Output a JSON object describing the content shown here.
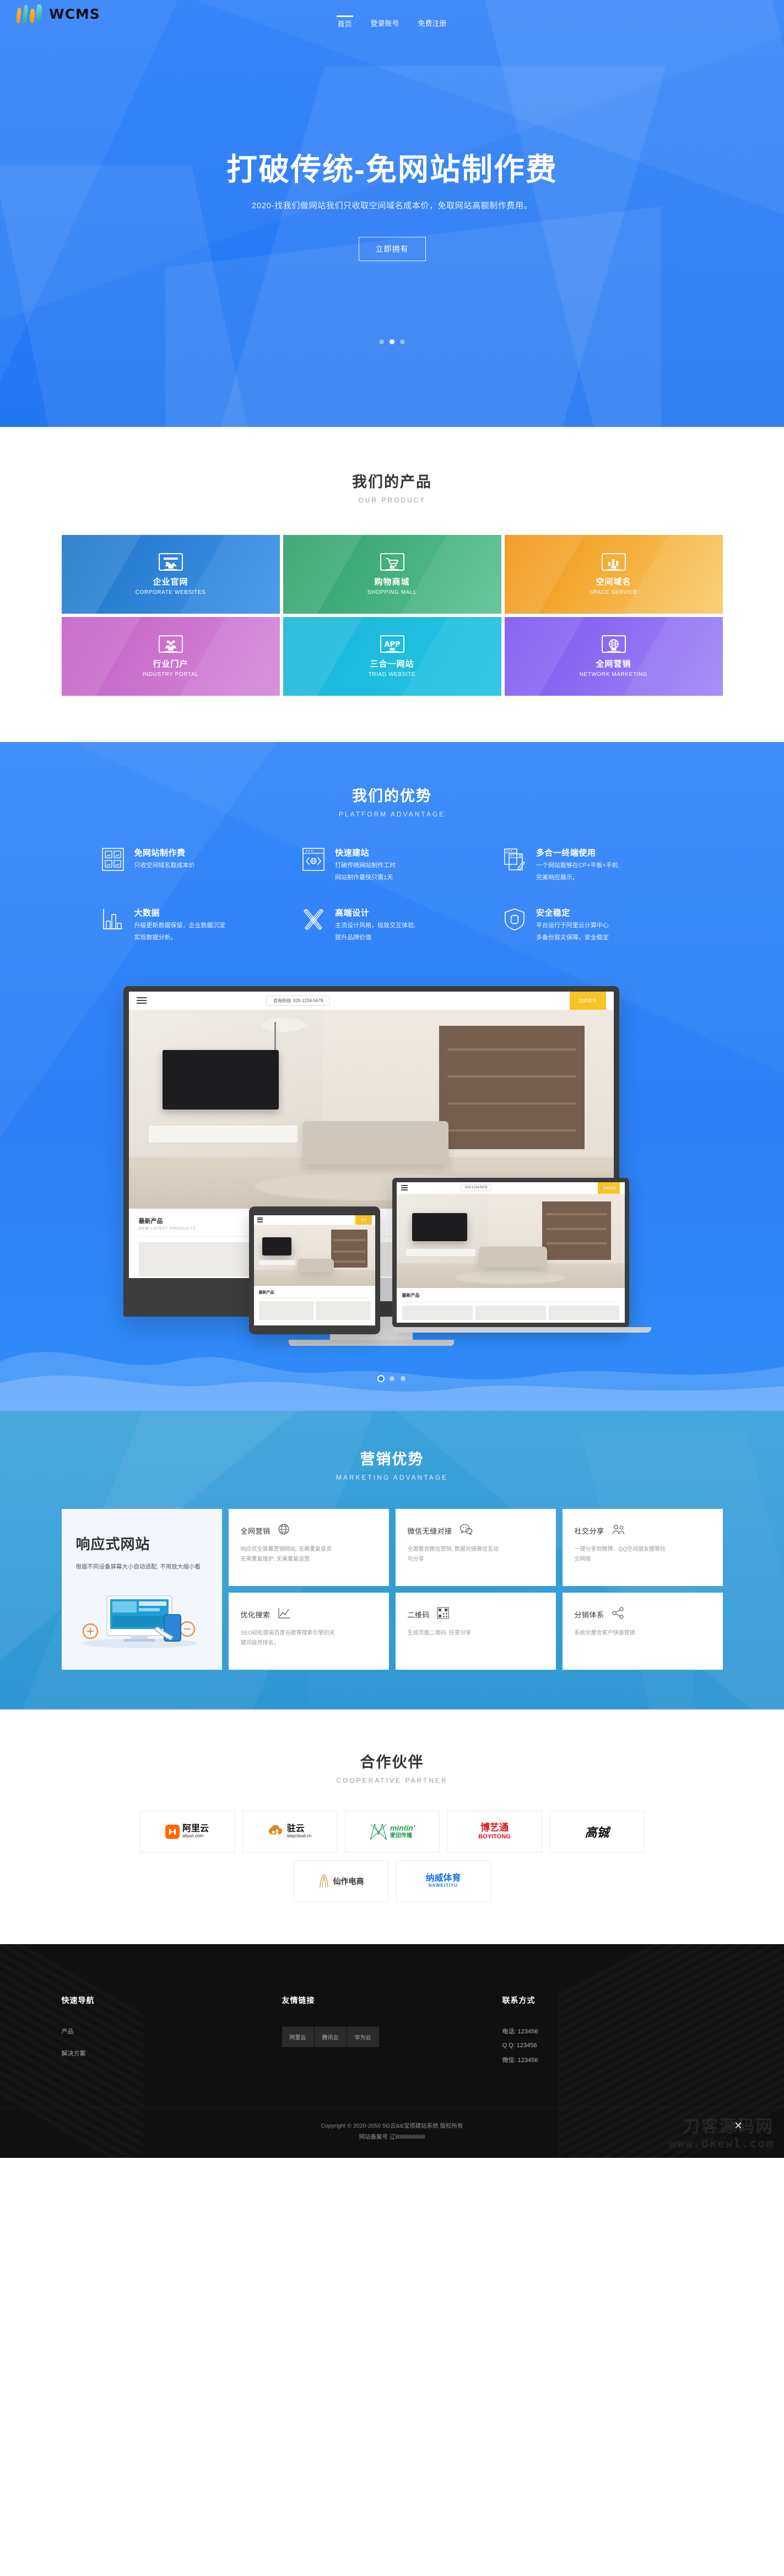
{
  "brand": {
    "name": "WCMS",
    "logo_icon": "wcms-logo-icon"
  },
  "nav": {
    "items": [
      {
        "label": "首页",
        "active": true
      },
      {
        "label": "登录账号",
        "active": false
      },
      {
        "label": "免费注册",
        "active": false
      }
    ]
  },
  "hero": {
    "title": "打破传统-免网站制作费",
    "subtitle": "2020-找我们做网站我们只收取空间域名成本价，免取网站高额制作费用。",
    "button": "立即拥有",
    "slides": 3,
    "active_slide": 2
  },
  "products": {
    "heading_cn": "我们的产品",
    "heading_en": "OUR PRODUCT",
    "cards": [
      {
        "cn": "企业官网",
        "en": "CORPORATE WEBSITES",
        "icon": "monitor-image-icon",
        "color_from": "#1f76c8",
        "color_to": "#3f93ea"
      },
      {
        "cn": "购物商城",
        "en": "SHOPPING MALL",
        "icon": "monitor-cart-icon",
        "color_from": "#2d9f68",
        "color_to": "#5ec296"
      },
      {
        "cn": "空间域名",
        "en": "SPACE SERVICE",
        "icon": "monitor-chart-icon",
        "color_from": "#ef9311",
        "color_to": "#f8cc6a"
      },
      {
        "cn": "行业门户",
        "en": "INDUSTRY PORTAL",
        "icon": "monitor-users-icon",
        "color_from": "#c35ec4",
        "color_to": "#d58ada"
      },
      {
        "cn": "三合一网站",
        "en": "TRIAD WEBSITE",
        "icon": "monitor-app-icon",
        "color_from": "#18b6d8",
        "color_to": "#25c3e4"
      },
      {
        "cn": "全网营销",
        "en": "NETWORK MARKETING",
        "icon": "monitor-globe-icon",
        "color_from": "#7b54ef",
        "color_to": "#a287f7"
      }
    ]
  },
  "advantage": {
    "heading_cn": "我们的优势",
    "heading_en": "PLATFORM ADVANTAGE",
    "items": [
      {
        "title": "免网站制作费",
        "icon": "grid-images-icon",
        "desc": [
          "只收空间域名取成本价"
        ]
      },
      {
        "title": "快速建站",
        "icon": "browser-code-icon",
        "desc": [
          "打破传统网站制作工时",
          "网站制作最快只需1天"
        ]
      },
      {
        "title": "多合一终端使用",
        "icon": "multi-device-icon",
        "desc": [
          "一个网站能够在CP+平板+手机",
          "完美响应展示。"
        ]
      },
      {
        "title": "大数据",
        "icon": "bar-chart-icon",
        "desc": [
          "升级更新数据保留，企业数据沉淀",
          "实现数据分析。"
        ]
      },
      {
        "title": "高端设计",
        "icon": "pencil-ruler-icon",
        "desc": [
          "主流设计风格，极致交互体验,",
          "提升品牌价值"
        ]
      },
      {
        "title": "安全稳定",
        "icon": "shield-chip-icon",
        "desc": [
          "平台运行于阿里云计算中心",
          "多备份容灾保障，安全稳定"
        ]
      }
    ],
    "showcase": {
      "site_phone": "咨询热线: 020-1234-5678",
      "site_btn": "立即咨询",
      "panel_title": "最新产品",
      "panel_sub": "NEW LATEST PRODUCTS",
      "menu_icon": "hamburger-menu-icon",
      "phone_icon": "phone-icon"
    },
    "slides": 3,
    "active_slide": 1
  },
  "marketing": {
    "heading_cn": "营销优势",
    "heading_en": "MARKETING ADVANTAGE",
    "hero": {
      "title": "响应式网站",
      "desc": "根据不同设备屏幕大小自动适配, 不用放大缩小看",
      "icon": "responsive-devices-icon"
    },
    "cards": [
      {
        "title": "全网营销",
        "icon": "globe-icon",
        "desc": [
          "响应式全屏幕营销网站, 无需重复投资",
          "无需重复维护, 无需重复运营"
        ]
      },
      {
        "title": "微信无缝对接",
        "icon": "wechat-bubble-icon",
        "desc": [
          "全面整合微信营销, 数据对接微信互动",
          "与分享"
        ]
      },
      {
        "title": "社交分享",
        "icon": "social-share-users-icon",
        "desc": [
          "一键分享到微博、QQ空间朋友圈等社",
          "交网络"
        ]
      },
      {
        "title": "优化搜索",
        "icon": "seo-trend-icon",
        "desc": [
          "SEO轻松提高百度谷歌等搜索引擎的关",
          "键词自然排名。"
        ]
      },
      {
        "title": "二维码",
        "icon": "qr-code-icon",
        "desc": [
          "生成页面二维码, 任意分享"
        ]
      },
      {
        "title": "分销体系",
        "icon": "share-nodes-icon",
        "desc": [
          "系统化整合客户快速营销"
        ]
      }
    ]
  },
  "partners": {
    "heading_cn": "合作伙伴",
    "heading_en": "COOPERATIVE PARTNER",
    "row1": [
      {
        "name": "阿里云",
        "sub": "aliyun.com",
        "icon": "aliyun-logo-icon",
        "color": "#ff6a00"
      },
      {
        "name": "驻云",
        "sub": "staycloud.cn",
        "icon": "staycloud-logo-icon",
        "color": "#d9881d"
      },
      {
        "name": "mintin'",
        "sub": "麦田传播",
        "icon": "mintin-logo-icon",
        "color": "#1f9b4f"
      },
      {
        "name": "博艺通",
        "sub": "BOYITONG",
        "icon": "boyitong-logo-icon",
        "color": "#d2191c"
      },
      {
        "name": "高铖",
        "sub": "",
        "icon": "gaocheng-logo-icon",
        "color": "#111111"
      }
    ],
    "row2": [
      {
        "name": "仙作电商",
        "sub": "",
        "icon": "xianzuo-logo-icon",
        "color": "#c79a3c"
      },
      {
        "name": "纳威体育",
        "sub": "NAWEITIYU",
        "icon": "naweitiyu-logo-icon",
        "color": "#1a73e8"
      }
    ]
  },
  "footer": {
    "quick_nav": {
      "title": "快速导航",
      "items": [
        "产品",
        "解决方案"
      ]
    },
    "friend_links": {
      "title": "友情链接",
      "items": [
        "阿里云",
        "腾讯云",
        "华为云"
      ]
    },
    "contact": {
      "title": "联系方式",
      "lines": [
        "电话: 123456",
        "Q Q: 123456",
        "微信: 123456"
      ]
    },
    "copyright": "Copyright © 2020-2050 5G云&&宝塔建站系统 版权所有",
    "icp_label": "网站备案号",
    "icp_value": "辽B88888888",
    "watermark_line1": "刀客源码网",
    "watermark_line2": "www.dkewl.com",
    "watermark_close": "✕"
  }
}
